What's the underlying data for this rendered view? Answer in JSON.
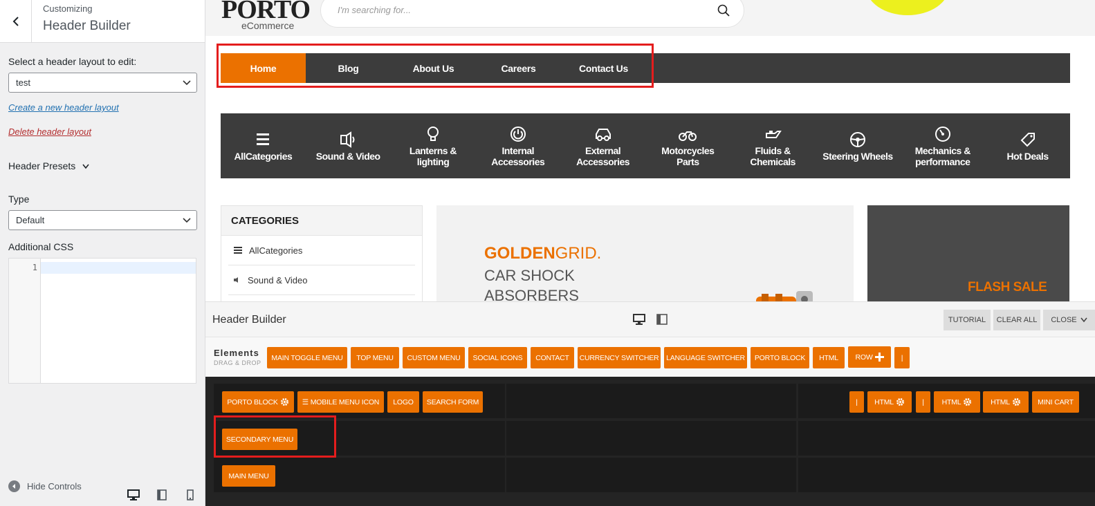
{
  "customizer": {
    "subtitle": "Customizing",
    "title": "Header Builder",
    "select_layout_label": "Select a header layout to edit:",
    "layout_value": "test",
    "create_link": "Create a new header layout",
    "delete_link": "Delete header layout",
    "presets_label": "Header Presets",
    "type_label": "Type",
    "type_value": "Default",
    "css_label": "Additional CSS",
    "css_line": "1",
    "hide_controls": "Hide Controls"
  },
  "site": {
    "logo": "PORTO",
    "logo_sub": "eCommerce",
    "search_placeholder": "I'm searching for...",
    "nav": [
      "Home",
      "Blog",
      "About Us",
      "Careers",
      "Contact Us"
    ],
    "categories_bar": [
      {
        "label": "AllCategories",
        "icon": "menu-icon"
      },
      {
        "label": "Sound & Video",
        "icon": "speaker-icon"
      },
      {
        "label": "Lanterns & lighting",
        "icon": "bulb-icon"
      },
      {
        "label": "Internal Accessories",
        "icon": "power-icon"
      },
      {
        "label": "External Accessories",
        "icon": "car-icon"
      },
      {
        "label": "Motorcycles Parts",
        "icon": "motorcycle-icon"
      },
      {
        "label": "Fluids & Chemicals",
        "icon": "oil-can-icon"
      },
      {
        "label": "Steering Wheels",
        "icon": "steering-wheel-icon"
      },
      {
        "label": "Mechanics & performance",
        "icon": "gauge-icon"
      },
      {
        "label": "Hot Deals",
        "icon": "tag-icon"
      }
    ],
    "sidebar_title": "CATEGORIES",
    "sidebar_items": [
      "AllCategories",
      "Sound & Video"
    ],
    "banner": {
      "brand_bold": "GOLDEN",
      "brand_light": "GRID.",
      "line1": "CAR SHOCK",
      "line2": "ABSORBERS"
    },
    "flash": "FLASH SALE"
  },
  "builder": {
    "title": "Header Builder",
    "buttons": {
      "tutorial": "TUTORIAL",
      "clear_all": "CLEAR ALL",
      "close": "CLOSE"
    },
    "elements_title": "Elements",
    "elements_sub": "DRAG & DROP",
    "elements": [
      "MAIN TOGGLE MENU",
      "TOP MENU",
      "CUSTOM MENU",
      "SOCIAL ICONS",
      "CONTACT",
      "CURRENCY SWITCHER",
      "LANGUAGE SWITCHER",
      "PORTO BLOCK",
      "HTML",
      "ROW",
      "|"
    ],
    "row1_left": [
      "PORTO BLOCK",
      "☰ MOBILE MENU ICON",
      "LOGO",
      "SEARCH FORM"
    ],
    "row1_right": [
      "|",
      "HTML",
      "|",
      "HTML",
      "HTML",
      "MINI CART"
    ],
    "row2_left": [
      "SECONDARY MENU"
    ],
    "row3_left": [
      "MAIN MENU"
    ]
  },
  "colors": {
    "accent": "#eb7100",
    "nav_bg": "#3c3c3c",
    "highlight": "#e41d1d"
  }
}
